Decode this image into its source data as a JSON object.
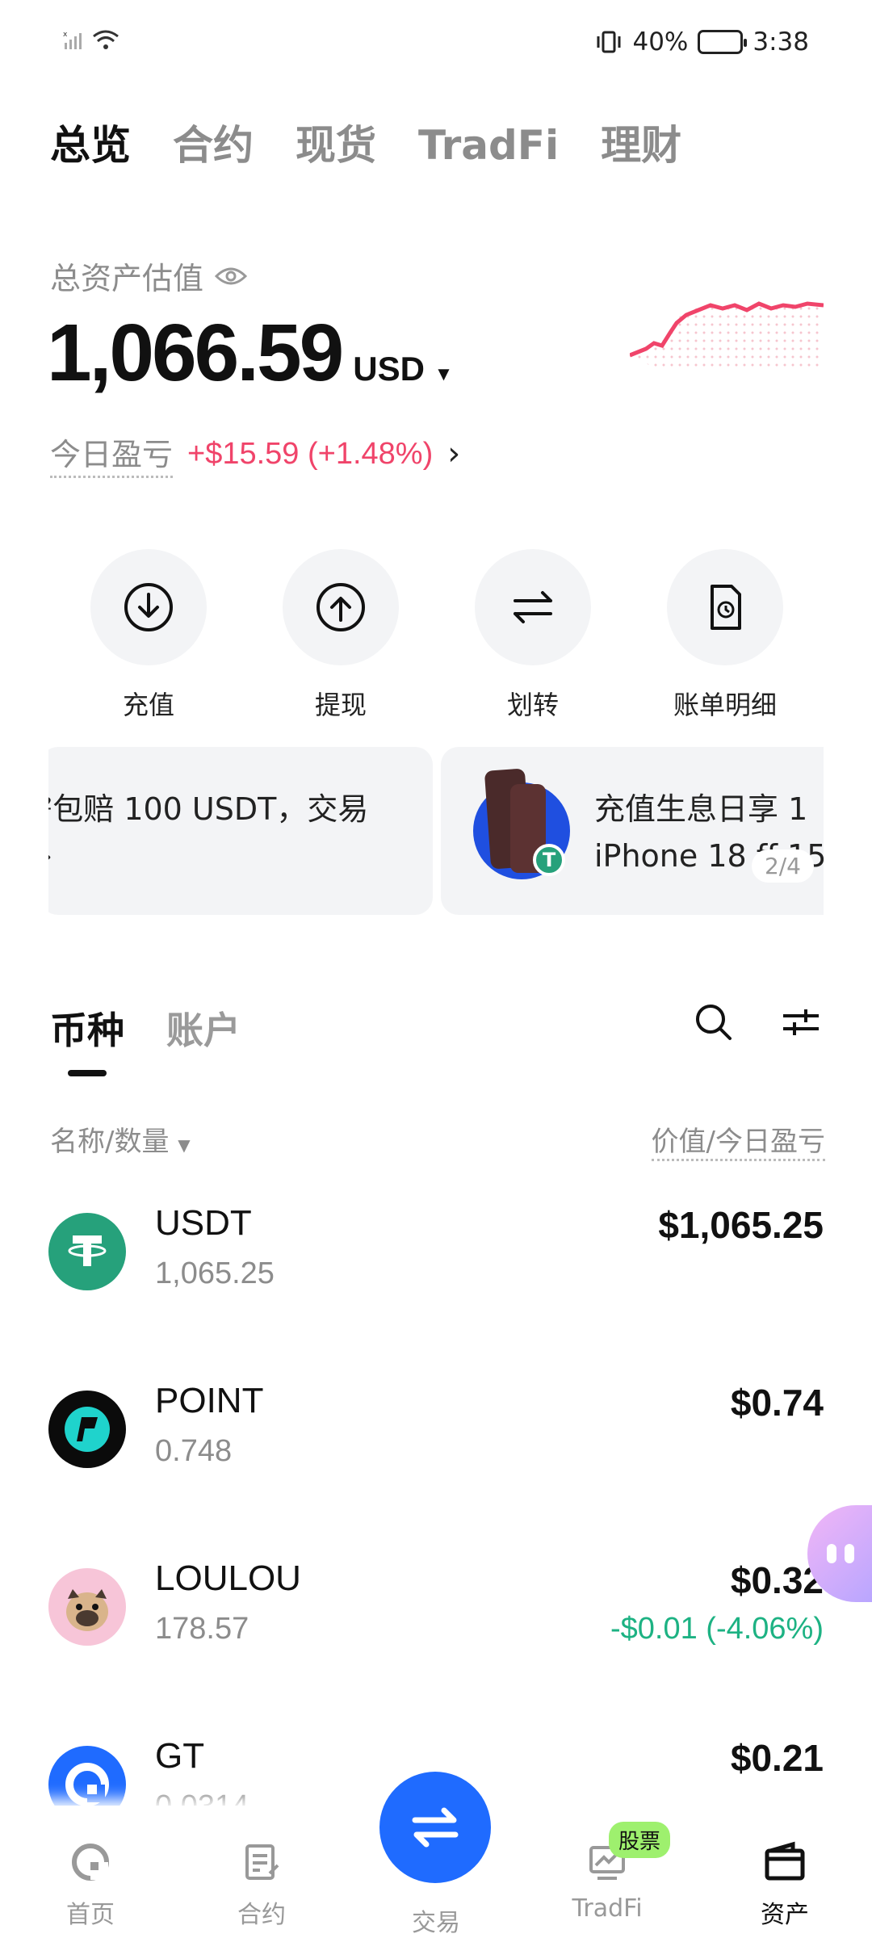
{
  "status_bar": {
    "battery": "40%",
    "time": "3:38"
  },
  "top_tabs": [
    {
      "label": "总览",
      "active": true
    },
    {
      "label": "合约",
      "active": false
    },
    {
      "label": "现货",
      "active": false
    },
    {
      "label": "TradFi",
      "active": false
    },
    {
      "label": "理财",
      "active": false
    }
  ],
  "summary": {
    "label": "总资产估值",
    "amount": "1,066.59",
    "currency": "USD",
    "pnl_label": "今日盈亏",
    "pnl_value": "+$15.59 (+1.48%)",
    "pnl_color": "#f0446a"
  },
  "actions": [
    {
      "label": "充值",
      "icon": "deposit-icon"
    },
    {
      "label": "提现",
      "icon": "withdraw-icon"
    },
    {
      "label": "划转",
      "icon": "transfer-icon"
    },
    {
      "label": "账单明细",
      "icon": "bill-icon"
    }
  ],
  "banners": [
    {
      "line1": "²包赔 100 USDT，交易",
      "line2": "›"
    },
    {
      "line1": "充值生息日享 1",
      "line2": "iPhone 18 ff 15",
      "pager": "2/4"
    }
  ],
  "list_tabs": [
    {
      "label": "币种",
      "active": true
    },
    {
      "label": "账户",
      "active": false
    }
  ],
  "columns": {
    "left": "名称/数量",
    "right": "价值/今日盈亏"
  },
  "coins": [
    {
      "symbol": "USDT",
      "quantity": "1,065.25",
      "value": "$1,065.25",
      "change": "",
      "logo_color": "#26a17b"
    },
    {
      "symbol": "POINT",
      "quantity": "0.748",
      "value": "$0.74",
      "change": "",
      "logo_color": "#0b0b0b"
    },
    {
      "symbol": "LOULOU",
      "quantity": "178.57",
      "value": "$0.32",
      "change": "-$0.01 (-4.06%)",
      "logo_color": "#f7c5d8"
    },
    {
      "symbol": "GT",
      "quantity": "0.0314",
      "value": "$0.21",
      "change": "",
      "logo_color": "#1f6bff"
    }
  ],
  "bottom_nav": [
    {
      "label": "首页",
      "icon": "home-icon"
    },
    {
      "label": "合约",
      "icon": "contract-icon"
    },
    {
      "label": "交易",
      "icon": "trade-icon"
    },
    {
      "label": "TradFi",
      "icon": "tradfi-icon",
      "badge": "股票"
    },
    {
      "label": "资产",
      "icon": "wallet-icon",
      "active": true
    }
  ],
  "colors": {
    "accent": "#1f6bff",
    "gain": "#f0446a",
    "loss": "#1db283"
  }
}
